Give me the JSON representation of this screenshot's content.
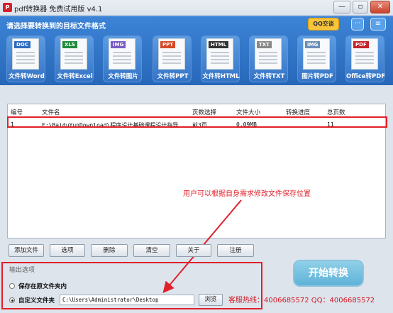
{
  "window": {
    "title": "pdf转换器 免费试用版 v4.1",
    "minimize": "—",
    "maximize": "▫",
    "close": "✕"
  },
  "banner": {
    "title": "请选择要转换到的目标文件格式",
    "qq_badge": "QQ交谈",
    "chat_badge": "···",
    "menu_badge": "≡"
  },
  "converters": [
    {
      "tag": "DOC",
      "label": "文件转Word",
      "color": "#2f6cc1"
    },
    {
      "tag": "XLS",
      "label": "文件转Excel",
      "color": "#1e8a3b"
    },
    {
      "tag": "IMG",
      "label": "文件转图片",
      "color": "#7a5cc4"
    },
    {
      "tag": "PPT",
      "label": "文件转PPT",
      "color": "#d34a2a"
    },
    {
      "tag": "HTML",
      "label": "文件转HTML",
      "color": "#333333"
    },
    {
      "tag": "TXT",
      "label": "文件转TXT",
      "color": "#888888"
    },
    {
      "tag": "IMG",
      "label": "图片转PDF",
      "color": "#6a8fb8"
    },
    {
      "tag": "PDF",
      "label": "Office转PDF",
      "color": "#c5242c"
    }
  ],
  "table": {
    "headers": [
      "编号",
      "文件名",
      "页数选择",
      "文件大小",
      "转换进度",
      "总页数"
    ],
    "rows": [
      [
        "1",
        "E:\\BaiduYunDownload\\程序设计基础课程设计指导...",
        "前3页",
        "0.09MB",
        "",
        "11"
      ]
    ]
  },
  "toolbar": [
    "添加文件",
    "选项",
    "删除",
    "清空",
    "关于",
    "注册"
  ],
  "output": {
    "legend": "输出选项",
    "keep_original": "保存在原文件夹内",
    "custom_folder": "自定义文件夹",
    "path": "C:\\Users\\Administrator\\Desktop",
    "browse": "浏览"
  },
  "annotation": "用户可以根据自身需求修改文件保存位置",
  "start_button": "开始转换",
  "hotline": "客服热线：4006685572 QQ：4006685572",
  "colors": {
    "accent_red": "#e0202a",
    "banner_blue": "#2f72c4",
    "start_button": "#6fbfe0"
  }
}
